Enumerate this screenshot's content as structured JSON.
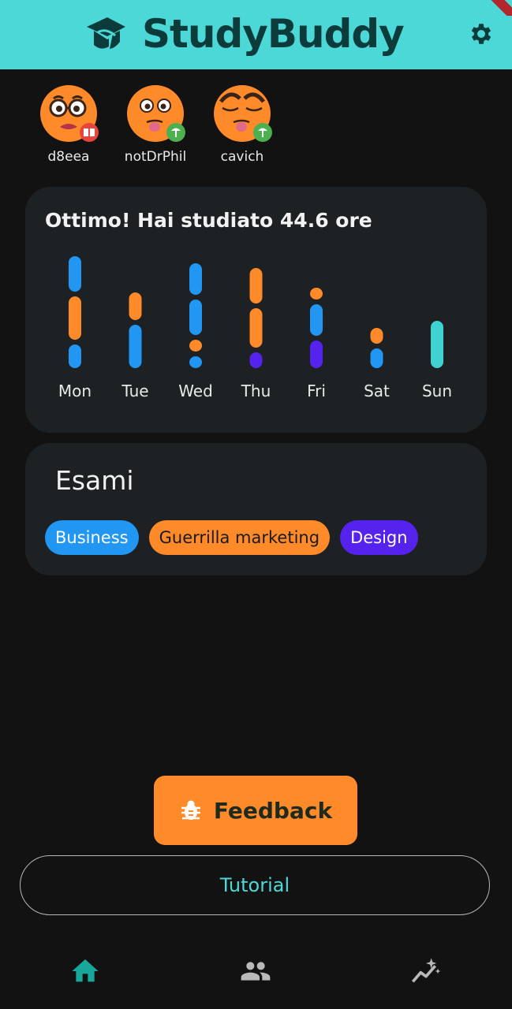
{
  "app": {
    "title": "StudyBuddy",
    "accent": "#4dd8d8",
    "background": "#121212",
    "icons": {
      "logo": "graduation-cap-icon",
      "settings": "gear-icon"
    }
  },
  "friends": [
    {
      "name": "d8eea",
      "status_icon": "book-icon",
      "status_color": "#e8453c"
    },
    {
      "name": "notDrPhil",
      "status_icon": "umbrella-icon",
      "status_color": "#4caf50"
    },
    {
      "name": "cavich",
      "status_icon": "umbrella-icon",
      "status_color": "#4caf50"
    }
  ],
  "stats": {
    "title": "Ottimo! Hai studiato 44.6 ore"
  },
  "chart_data": {
    "type": "bar",
    "stacked": true,
    "categories": [
      "Mon",
      "Tue",
      "Wed",
      "Thu",
      "Fri",
      "Sat",
      "Sun"
    ],
    "segments": [
      [
        {
          "color": "#2196f3",
          "value": 4.5
        },
        {
          "color": "#ff8a2a",
          "value": 5.5
        },
        {
          "color": "#2196f3",
          "value": 3
        }
      ],
      [
        {
          "color": "#ff8a2a",
          "value": 3.5
        },
        {
          "color": "#2196f3",
          "value": 5.5
        }
      ],
      [
        {
          "color": "#2196f3",
          "value": 4
        },
        {
          "color": "#2196f3",
          "value": 4.5
        },
        {
          "color": "#ff8a2a",
          "value": 1.5
        },
        {
          "color": "#2196f3",
          "value": 1.5
        }
      ],
      [
        {
          "color": "#ff8a2a",
          "value": 4.5
        },
        {
          "color": "#ff8a2a",
          "value": 5
        },
        {
          "color": "#5522ee",
          "value": 2
        }
      ],
      [
        {
          "color": "#ff8a2a",
          "value": 1.5
        },
        {
          "color": "#2196f3",
          "value": 4
        },
        {
          "color": "#5522ee",
          "value": 3.5
        }
      ],
      [
        {
          "color": "#ff8a2a",
          "value": 2
        },
        {
          "color": "#2196f3",
          "value": 2.5
        }
      ],
      [
        {
          "color": "#40d1d1",
          "value": 6
        }
      ]
    ],
    "colors": {
      "Business": "#2196f3",
      "Guerrilla marketing": "#ff8a2a",
      "Design": "#5522ee",
      "other": "#40d1d1"
    }
  },
  "exams": {
    "title": "Esami",
    "chips": [
      {
        "label": "Business",
        "color": "#2196f3",
        "text_color": "#ffffff"
      },
      {
        "label": "Guerrilla marketing",
        "color": "#ff8a2a",
        "text_color": "#1a1a1a"
      },
      {
        "label": "Design",
        "color": "#5522ee",
        "text_color": "#ffffff"
      }
    ]
  },
  "buttons": {
    "feedback": "Feedback",
    "feedback_icon": "bug-icon",
    "tutorial": "Tutorial"
  },
  "nav": {
    "items": [
      {
        "icon": "home-icon",
        "active": true
      },
      {
        "icon": "people-icon",
        "active": false
      },
      {
        "icon": "stats-sparkle-icon",
        "active": false
      }
    ]
  }
}
